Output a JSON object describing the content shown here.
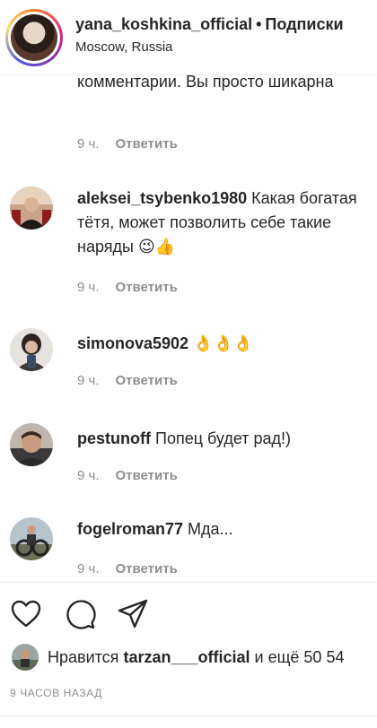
{
  "header": {
    "username": "yana_koshkina_official",
    "separator": "•",
    "follow_label": "Подписки",
    "location": "Moscow, Russia"
  },
  "previous_comment": {
    "text_cut": "комментарии. Вы просто шикарна",
    "time": "9 ч.",
    "reply_label": "Ответить"
  },
  "comments": [
    {
      "user": "aleksei_tsybenko1980",
      "text": "Какая богатая тётя, может позволить себе такие наряды",
      "emoji": "😉👍",
      "time": "9 ч.",
      "reply_label": "Ответить"
    },
    {
      "user": "simonova5902",
      "text": "",
      "emoji": "👌👌👌",
      "time": "9 ч.",
      "reply_label": "Ответить"
    },
    {
      "user": "pestunoff",
      "text": "Попец будет рад!)",
      "emoji": "",
      "time": "9 ч.",
      "reply_label": "Ответить"
    },
    {
      "user": "fogelroman77",
      "text": "Мда...",
      "emoji": "",
      "time": "9 ч.",
      "reply_label": "Ответить"
    }
  ],
  "actions": {
    "icons": [
      "heart-icon",
      "comment-icon",
      "share-icon"
    ]
  },
  "likes": {
    "prefix": "Нравится",
    "user": "tarzan___official",
    "suffix": "и ещё 50 54"
  },
  "post_time": "9 ЧАСОВ НАЗАД"
}
